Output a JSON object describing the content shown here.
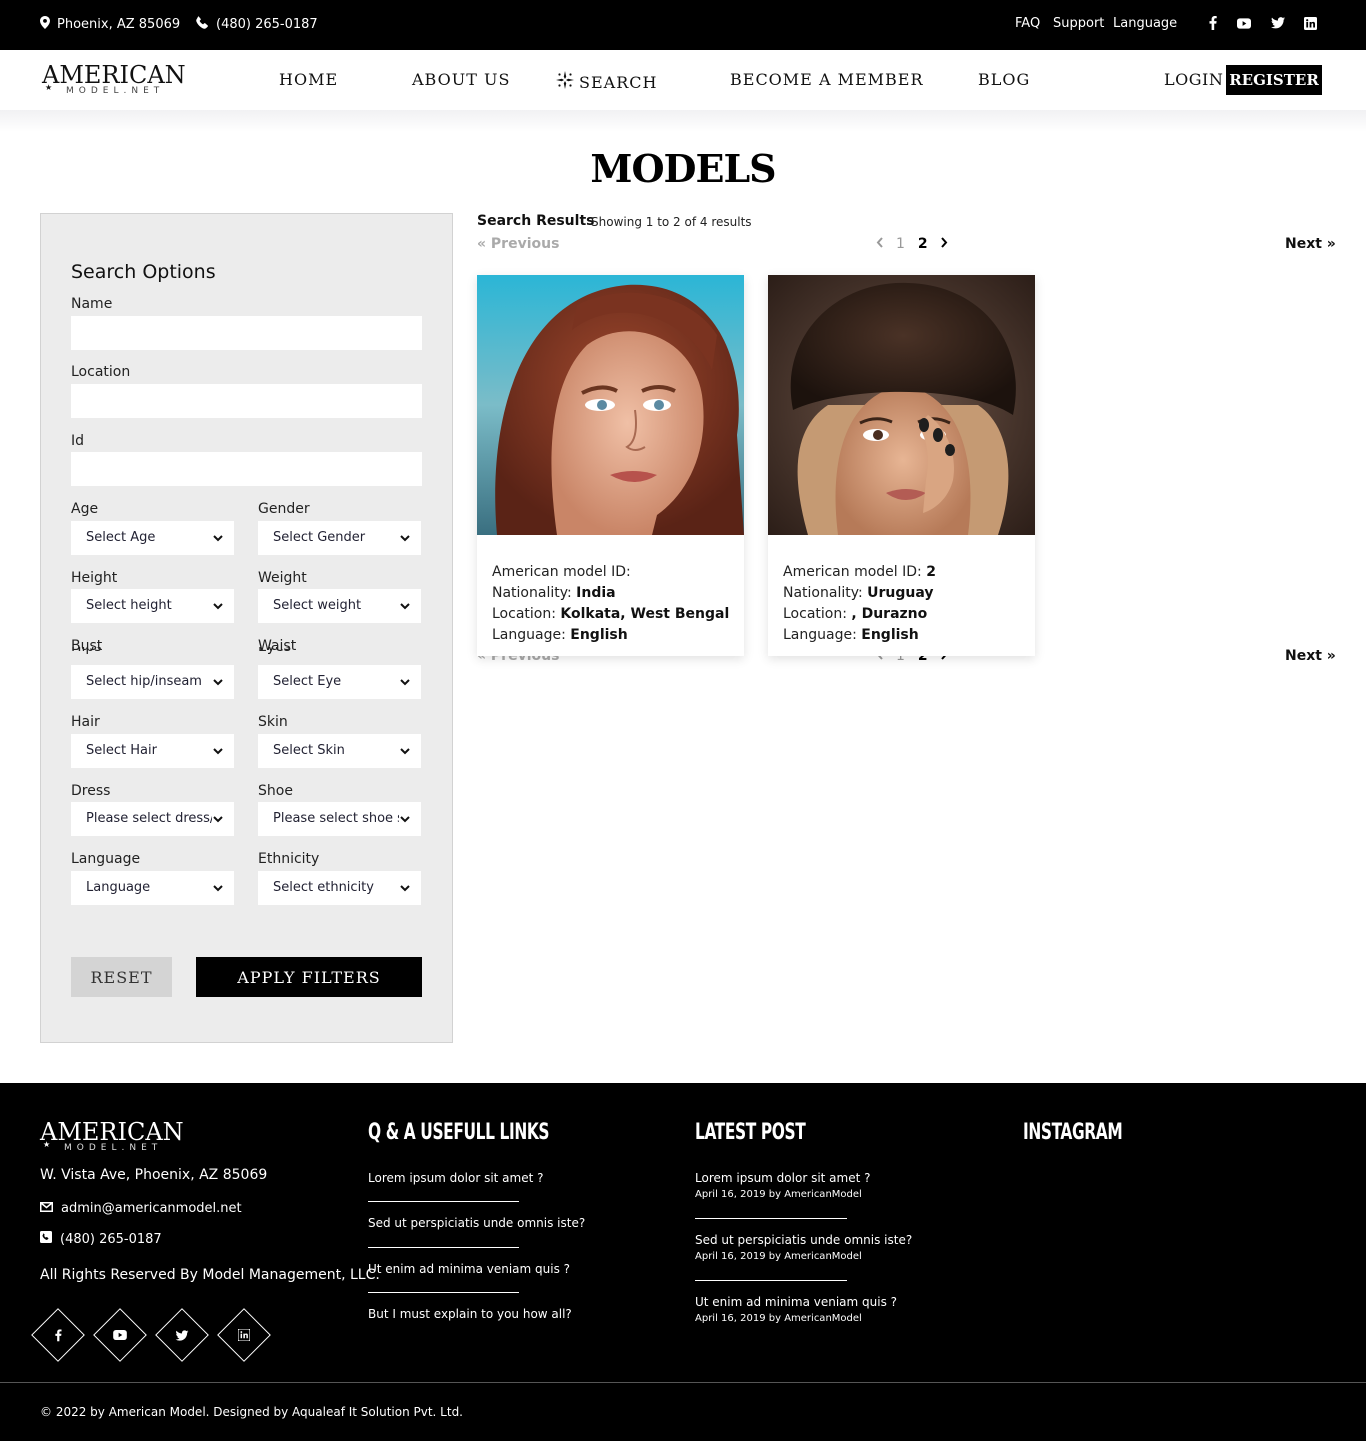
{
  "topbar": {
    "location": "Phoenix, AZ 85069",
    "phone": "(480) 265-0187",
    "links": [
      "FAQ",
      "Support",
      "Language"
    ],
    "social_icons": [
      "facebook-icon",
      "youtube-icon",
      "twitter-icon",
      "linkedin-icon"
    ]
  },
  "brand": {
    "logo_main": "AMERICAN",
    "logo_sub": "MODEL.NET"
  },
  "nav": {
    "items": [
      "HOME",
      "ABOUT US",
      "SEARCH",
      "BECOME A MEMBER",
      "BLOG"
    ],
    "login": "LOGIN",
    "register": "REGISTER"
  },
  "page": {
    "title": "MODELS"
  },
  "search_panel": {
    "title": "Search Options",
    "name_label": "Name",
    "location_label": "Location",
    "id_label": "Id",
    "age_label": "Age",
    "age_value": "Select Age",
    "gender_label": "Gender",
    "gender_value": "Select Gender",
    "height_label": "Height",
    "height_value": "Select height",
    "weight_label": "Weight",
    "weight_value": "Select weight",
    "bust_label": "Bust",
    "bust_overlap_label": "Hips",
    "bust_value": "Select hip/inseam",
    "waist_label": "Waist",
    "waist_overlap_label": "Eyes",
    "waist_value": "Select Eye",
    "hair_label": "Hair",
    "hair_value": "Select Hair",
    "skin_label": "Skin",
    "skin_value": "Select Skin",
    "dress_label": "Dress",
    "dress_value": "Please select dress/",
    "shoe_label": "Shoe",
    "shoe_value": "Please select shoe s",
    "language_label": "Language",
    "language_value": "Language",
    "ethnicity_label": "Ethnicity",
    "ethnicity_value": "Select ethnicity",
    "reset": "RESET",
    "apply": "APPLY FILTERS"
  },
  "results": {
    "label": "Search Results",
    "count": "Showing 1 to 2 of 4 results",
    "previous": "« Previous",
    "next": "Next »",
    "pages": [
      "1",
      "2"
    ],
    "current_page": "2"
  },
  "cards": [
    {
      "id_label": "American model ID:",
      "id_value": "",
      "nationality_label": "Nationality:",
      "nationality": "India",
      "location_label": "Location:",
      "location": "Kolkata, West Bengal",
      "language_label": "Language:",
      "language": "English"
    },
    {
      "id_label": "American model ID:",
      "id_value": "2",
      "nationality_label": "Nationality:",
      "nationality": "Uruguay",
      "location_label": "Location:",
      "location": ", Durazno",
      "language_label": "Language:",
      "language": "English"
    }
  ],
  "footer": {
    "address": "W. Vista Ave, Phoenix, AZ 85069",
    "email": "admin@americanmodel.net",
    "phone": "(480) 265-0187",
    "rights": "All Rights Reserved By Model Management, LLC.",
    "links_heading": "Q & A USEFULL LINKS",
    "links": [
      "Lorem ipsum dolor sit amet ?",
      "Sed ut perspiciatis unde omnis iste?",
      "Ut enim ad minima veniam quis ?",
      "But I must explain to you how all?"
    ],
    "posts_heading": "LATEST POST",
    "posts": [
      {
        "title": "Lorem ipsum dolor sit amet ?",
        "meta": "April 16, 2019 by AmericanModel"
      },
      {
        "title": "Sed ut perspiciatis unde omnis iste?",
        "meta": "April 16, 2019 by AmericanModel"
      },
      {
        "title": "Ut enim ad minima veniam quis ?",
        "meta": "April 16, 2019 by AmericanModel"
      }
    ],
    "instagram_heading": "INSTAGRAM",
    "copyright": "© 2022 by American Model. Designed by Aqualeaf It Solution Pvt. Ltd."
  }
}
